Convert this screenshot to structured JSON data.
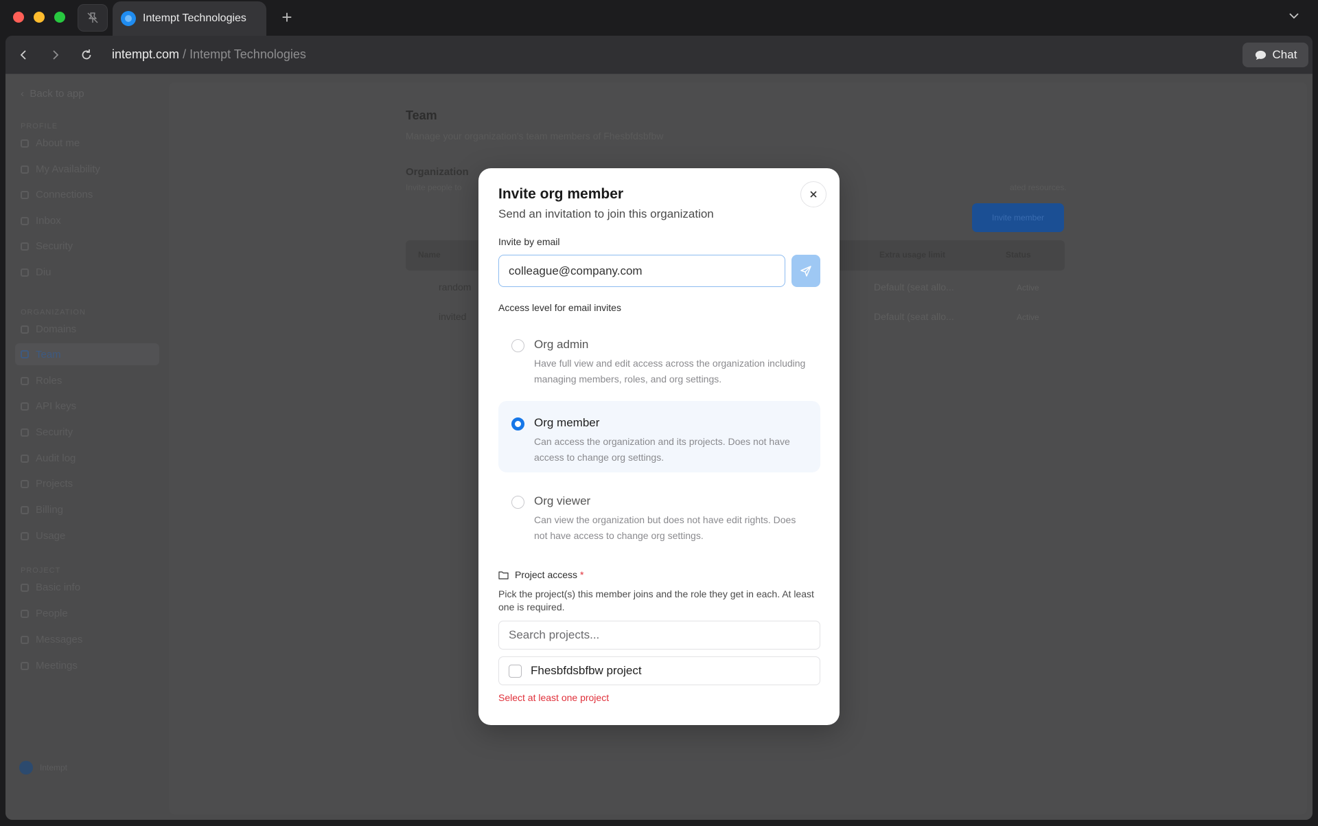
{
  "browser": {
    "tab_title": "Intempt Technologies",
    "url_domain": "intempt.com",
    "url_separator": "/",
    "url_path": "Intempt Technologies",
    "chat_label": "Chat"
  },
  "sidebar": {
    "back_label": "Back to app",
    "profile_label": "PROFILE",
    "profile_items": [
      "About me",
      "My Availability",
      "Connections",
      "Inbox",
      "Security",
      "Diu"
    ],
    "organization_label": "ORGANIZATION",
    "organization_items": [
      "Domains",
      "Team",
      "Roles",
      "API keys",
      "Security",
      "Audit log",
      "Projects",
      "Billing",
      "Usage"
    ],
    "project_label": "PROJECT",
    "project_items": [
      "Basic info",
      "People",
      "Messages",
      "Meetings"
    ],
    "footer_label": "Intempt"
  },
  "page": {
    "title": "Team",
    "subtitle": "Manage your organization's team members of Fhesbfdsbfbw",
    "section_title": "Organization",
    "section_desc_start": "Invite people to",
    "section_desc_end": "ated resources.",
    "invite_button": "Invite member",
    "table_headers": {
      "name": "Name",
      "extra_usage": "Extra usage limit",
      "status": "Status"
    },
    "rows": [
      {
        "name": "random",
        "extra": "Default (seat allo...",
        "status": "Active"
      },
      {
        "name": "invited",
        "extra": "Default (seat allo...",
        "status": "Active"
      }
    ]
  },
  "modal": {
    "title": "Invite org member",
    "subtitle": "Send an invitation to join this organization",
    "email_label": "Invite by email",
    "email_value": "colleague@company.com",
    "access_label": "Access level for email invites",
    "options": [
      {
        "title": "Org admin",
        "description": "Have full view and edit access across the organization including managing members, roles, and org settings.",
        "selected": false
      },
      {
        "title": "Org member",
        "description": "Can access the organization and its projects. Does not have access to change org settings.",
        "selected": true
      },
      {
        "title": "Org viewer",
        "description": "Can view the organization but does not have edit rights. Does not have access to change org settings.",
        "selected": false
      }
    ],
    "project_label": "Project access",
    "required_mark": "*",
    "project_description": "Pick the project(s) this member joins and the role they get in each. At least one is required.",
    "search_placeholder": "Search projects...",
    "project_name": "Fhesbfdsbfbw project",
    "error": "Select at least one project"
  },
  "colors": {
    "accent": "#1677e8",
    "error": "#e0303a",
    "selected_bg": "#f3f7fd"
  }
}
